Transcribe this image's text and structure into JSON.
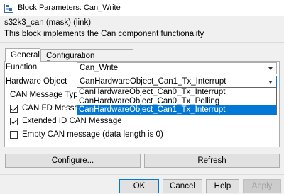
{
  "window": {
    "title": "Block Parameters: Can_Write"
  },
  "block": {
    "header": "s32k3_can (mask) (link)",
    "description": "This block implements the Can component functionality"
  },
  "tabs": [
    {
      "label": "General",
      "active": true
    },
    {
      "label": "Configuration Parameters",
      "active": false
    }
  ],
  "function": {
    "label": "Function",
    "value": "Can_Write"
  },
  "hardware_object": {
    "label": "Hardware Object",
    "value": "CanHardwareObject_Can1_Tx_Interrupt",
    "options": [
      "CanHardwareObject_Can0_Tx_Interrupt",
      "CanHardwareObject_Can0_Tx_Polling",
      "CanHardwareObject_Can1_Tx_Interrupt"
    ],
    "selected_index": 2
  },
  "can_message_type": {
    "label": "CAN Message Type"
  },
  "checkboxes": [
    {
      "label": "CAN FD Message",
      "checked": true
    },
    {
      "label": "Extended ID CAN Message",
      "checked": true
    },
    {
      "label": "Empty CAN message (data length is 0)",
      "checked": false
    }
  ],
  "actions": {
    "configure": "Configure...",
    "refresh": "Refresh"
  },
  "footer": {
    "ok": "OK",
    "cancel": "Cancel",
    "help": "Help",
    "apply": "Apply"
  },
  "colors": {
    "accent": "#0078d7",
    "window_bg": "#f0f0f0"
  }
}
